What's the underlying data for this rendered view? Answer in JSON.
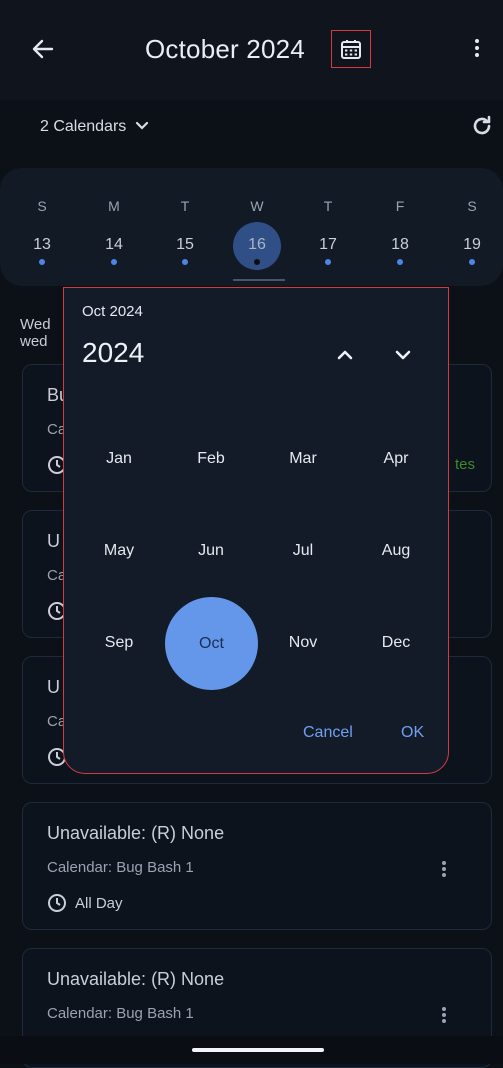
{
  "header": {
    "title": "October 2024"
  },
  "calendars": {
    "label": "2 Calendars"
  },
  "week": {
    "days": [
      "S",
      "M",
      "T",
      "W",
      "T",
      "F",
      "S"
    ],
    "dates": [
      "13",
      "14",
      "15",
      "16",
      "17",
      "18",
      "19"
    ]
  },
  "list": {
    "day_label_1": "Wed",
    "day_label_2": "wed",
    "partial_right": "tes",
    "cards": [
      {
        "title": "Bu",
        "calendar": "Ca",
        "time": ""
      },
      {
        "title": "U",
        "calendar": "Ca",
        "time": ""
      },
      {
        "title": "U",
        "calendar": "Ca",
        "time": ""
      },
      {
        "title": "Unavailable: (R) None",
        "calendar": "Calendar: Bug Bash 1",
        "time": "All Day"
      },
      {
        "title": "Unavailable: (R) None",
        "calendar": "Calendar: Bug Bash 1",
        "time": ""
      }
    ]
  },
  "dialog": {
    "subtitle": "Oct 2024",
    "year": "2024",
    "months": [
      "Jan",
      "Feb",
      "Mar",
      "Apr",
      "May",
      "Jun",
      "Jul",
      "Aug",
      "Sep",
      "Oct",
      "Nov",
      "Dec"
    ],
    "selected_month": "Oct",
    "cancel": "Cancel",
    "ok": "OK"
  },
  "colors": {
    "accent": "#6497ea",
    "highlight_border": "#d33b43"
  }
}
